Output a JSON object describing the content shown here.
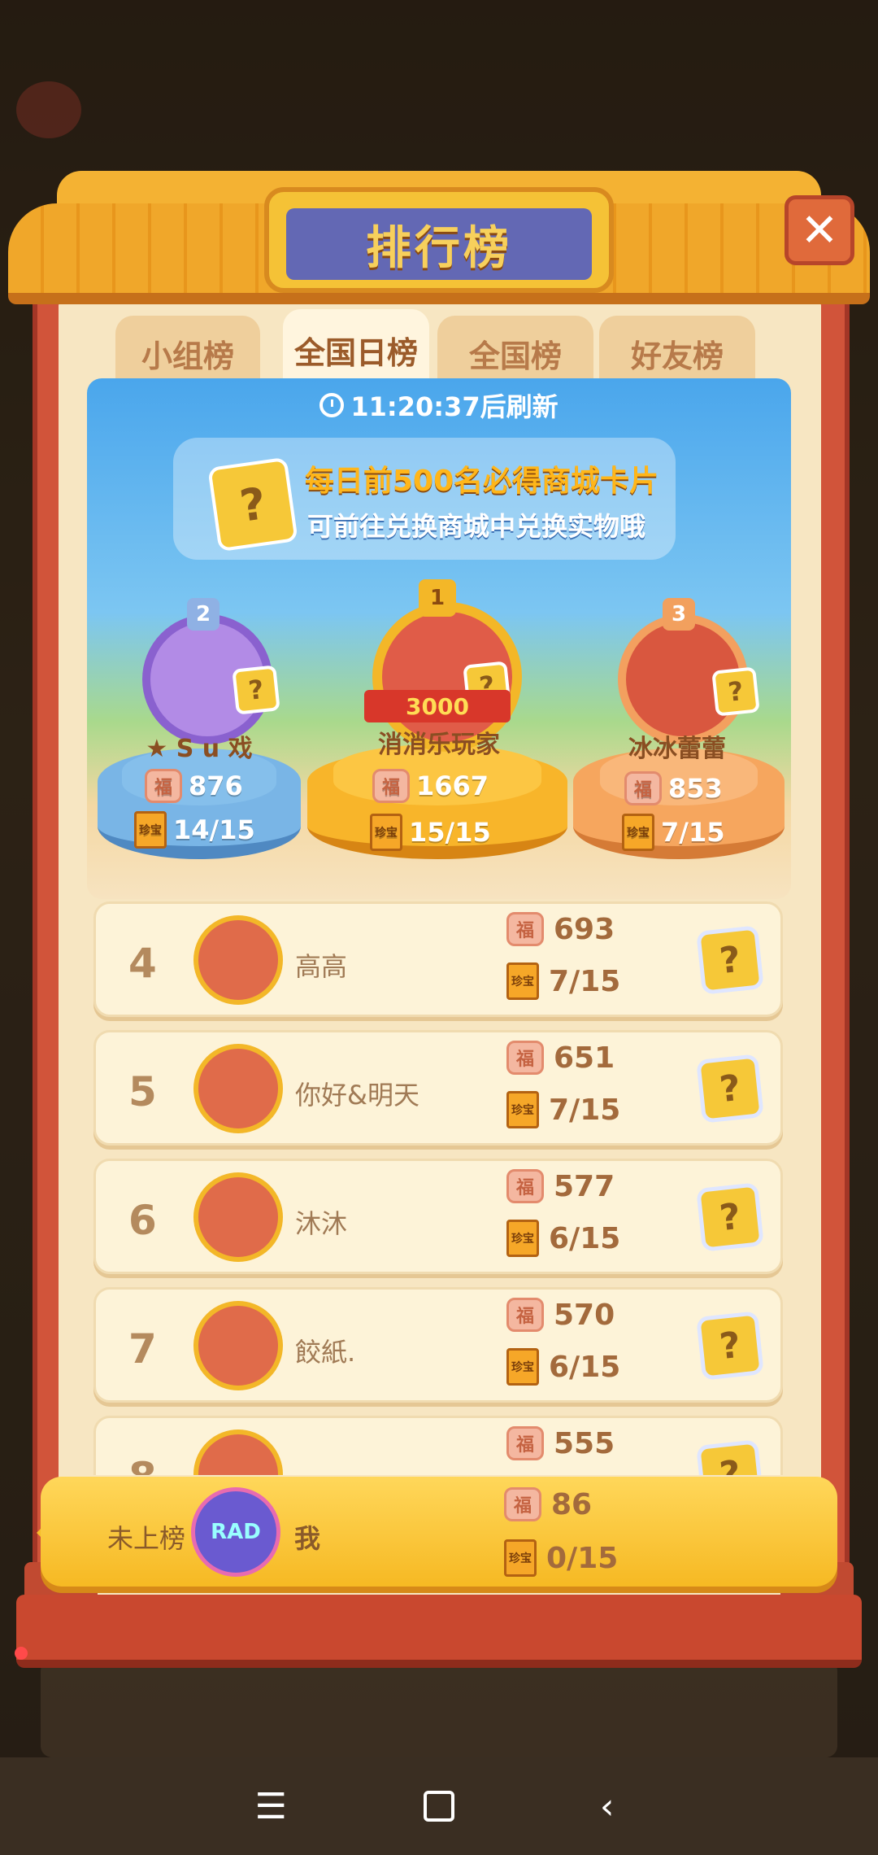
{
  "title": "排行榜",
  "close_symbol": "✕",
  "tabs": [
    {
      "label": "小组榜",
      "active": false
    },
    {
      "label": "全国日榜",
      "active": true
    },
    {
      "label": "全国榜",
      "active": false
    },
    {
      "label": "好友榜",
      "active": false
    }
  ],
  "refresh_text": "11:20:37后刷新",
  "banner": {
    "line1": "每日前500名必得商城卡片",
    "line2": "可前往兑换商城中兑换实物哦",
    "card_symbol": "?"
  },
  "podium": [
    {
      "rank": "2",
      "name": "★ S u 戏",
      "score": "876",
      "progress": "14/15"
    },
    {
      "rank": "1",
      "name": "消消乐玩家",
      "score": "1667",
      "progress": "15/15",
      "ribbon": "3000"
    },
    {
      "rank": "3",
      "name": "冰冰蕾蕾",
      "score": "853",
      "progress": "7/15"
    }
  ],
  "list": [
    {
      "rank": "4",
      "name": "高高",
      "score": "693",
      "progress": "7/15"
    },
    {
      "rank": "5",
      "name": "你好&明天",
      "score": "651",
      "progress": "7/15"
    },
    {
      "rank": "6",
      "name": "沐沐",
      "score": "577",
      "progress": "6/15"
    },
    {
      "rank": "7",
      "name": "餃紙.",
      "score": "570",
      "progress": "6/15"
    },
    {
      "rank": "8",
      "name": "",
      "score": "555",
      "progress": ""
    }
  ],
  "me": {
    "status": "未上榜",
    "name": "我",
    "avatar_text": "RAD",
    "score": "86",
    "progress": "0/15"
  },
  "icons": {
    "fu": "福",
    "book": "珍宝",
    "question": "?"
  },
  "nav": {
    "menu": "☰",
    "back": "‹"
  }
}
